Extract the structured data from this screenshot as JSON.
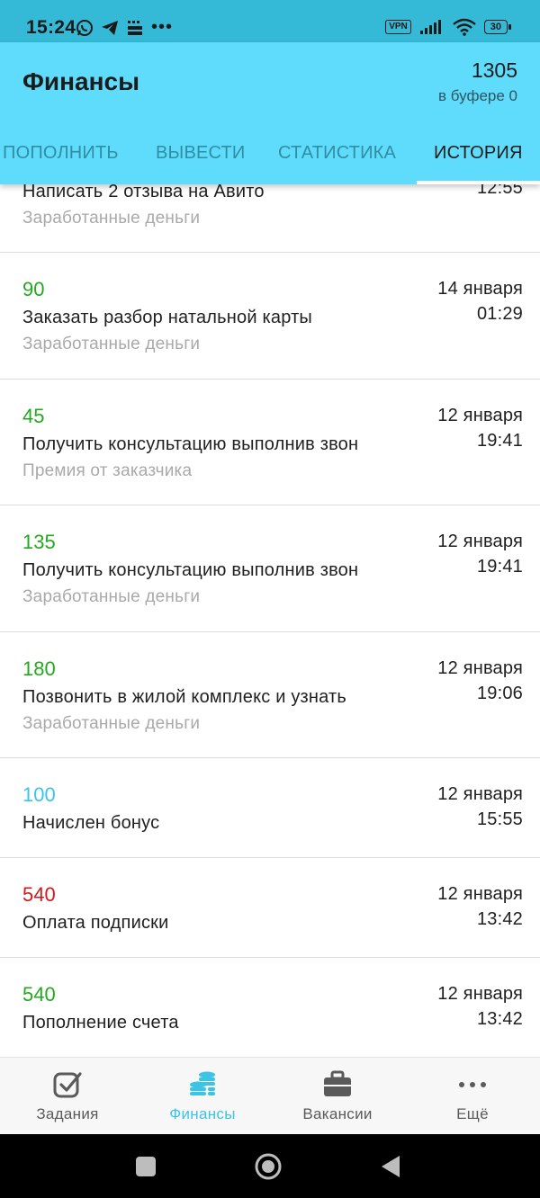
{
  "status_bar": {
    "time": "15:24",
    "vpn": "VPN",
    "battery": "30",
    "more": "•••"
  },
  "header": {
    "title": "Финансы",
    "balance": "1305",
    "buffer": "в буфере 0"
  },
  "tabs": [
    {
      "label": "ПОПОЛНИТЬ"
    },
    {
      "label": "ВЫВЕСТИ"
    },
    {
      "label": "СТАТИСТИКА"
    },
    {
      "label": "ИСТОРИЯ",
      "active": true
    }
  ],
  "history": [
    {
      "amount": "",
      "desc": "Написать 2 отзыва на Авито",
      "category": "Заработанные деньги",
      "date": "",
      "time": "12:55",
      "color": "green"
    },
    {
      "amount": "90",
      "desc": "Заказать разбор натальной карты",
      "category": "Заработанные деньги",
      "date": "14 января",
      "time": "01:29",
      "color": "green"
    },
    {
      "amount": "45",
      "desc": "Получить консультацию выполнив звон",
      "category": "Премия от заказчика",
      "date": "12 января",
      "time": "19:41",
      "color": "green"
    },
    {
      "amount": "135",
      "desc": "Получить консультацию выполнив звон",
      "category": "Заработанные деньги",
      "date": "12 января",
      "time": "19:41",
      "color": "green"
    },
    {
      "amount": "180",
      "desc": "Позвонить в жилой комплекс и узнать",
      "category": "Заработанные деньги",
      "date": "12 января",
      "time": "19:06",
      "color": "green"
    },
    {
      "amount": "100",
      "desc": "Начислен бонус",
      "category": "",
      "date": "12 января",
      "time": "15:55",
      "color": "blue"
    },
    {
      "amount": "540",
      "desc": "Оплата подписки",
      "category": "",
      "date": "12 января",
      "time": "13:42",
      "color": "red"
    },
    {
      "amount": "540",
      "desc": "Пополнение счета",
      "category": "",
      "date": "12 января",
      "time": "13:42",
      "color": "green"
    }
  ],
  "bottom_nav": [
    {
      "label": "Задания",
      "icon": "checkbox-icon"
    },
    {
      "label": "Финансы",
      "icon": "coins-icon",
      "active": true
    },
    {
      "label": "Вакансии",
      "icon": "briefcase-icon"
    },
    {
      "label": "Ещё",
      "icon": "more-icon"
    }
  ],
  "colors": {
    "header_bg": "#5fdcfb",
    "status_bg": "#34b9d6",
    "green": "#25a81f",
    "blue": "#3cc4e6",
    "red": "#d11a1a"
  }
}
